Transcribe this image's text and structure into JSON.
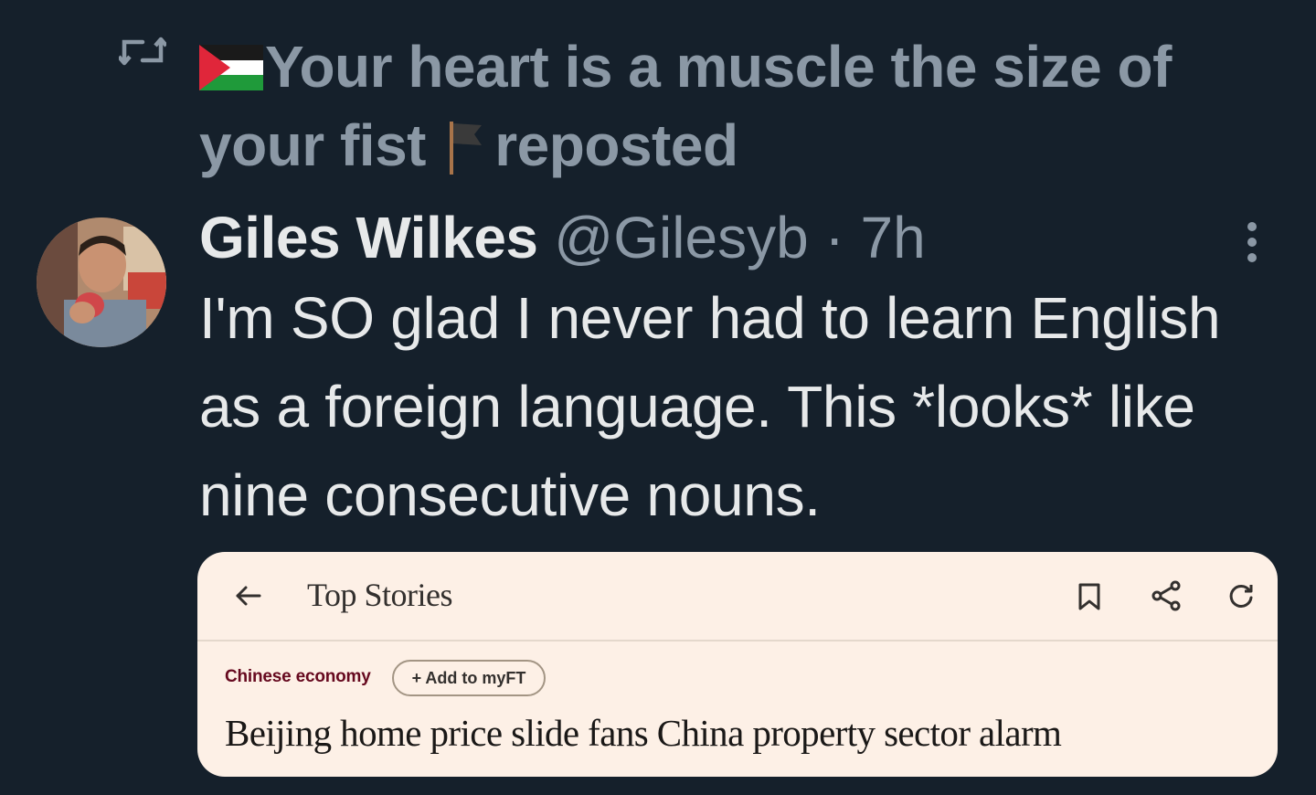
{
  "repost": {
    "icon": "repost-icon",
    "flag_icon": "palestine-flag-icon",
    "name_part1": "Your heart is a muscle the size of your fist",
    "flag2_icon": "black-flag-icon",
    "suffix": "reposted"
  },
  "tweet": {
    "author_name": "Giles Wilkes",
    "meta": "@Gilesyb · 7h",
    "more_icon": "more-vertical-icon",
    "text": "I'm SO glad I never had to learn English as a foreign language. This *looks* like nine consecutive nouns."
  },
  "card": {
    "back_icon": "arrow-left-icon",
    "title": "Top Stories",
    "bookmark_icon": "bookmark-icon",
    "share_icon": "share-icon",
    "refresh_icon": "refresh-icon",
    "topic": "Chinese economy",
    "myft_label": "+ Add to myFT",
    "headline": "Beijing home price slide fans China property sector alarm"
  },
  "colors": {
    "background": "#15202b",
    "muted": "#8b98a5",
    "text": "#e7e9ea",
    "card_bg": "#fdf0e6",
    "ft_claret": "#66091f"
  }
}
